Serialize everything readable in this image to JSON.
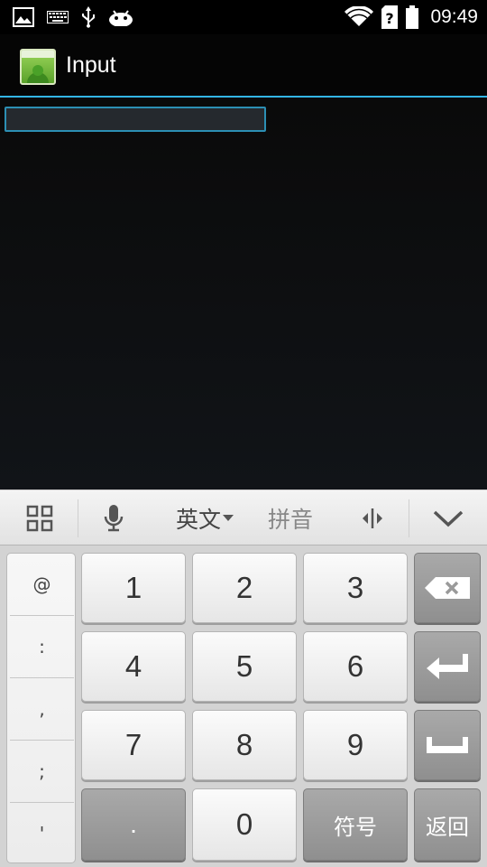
{
  "status_bar": {
    "time": "09:49",
    "left_icons": [
      "gallery-icon",
      "keyboard-icon",
      "usb-icon",
      "android-debug-icon"
    ],
    "right_icons": [
      "wifi-icon",
      "sim-unknown-icon",
      "battery-icon"
    ]
  },
  "action_bar": {
    "title": "Input",
    "accent_color": "#33b5e5"
  },
  "input": {
    "value": "",
    "placeholder": ""
  },
  "keyboard_toolbar": {
    "lang_label": "英文",
    "pinyin_label": "拼音"
  },
  "keyboard": {
    "symbols": [
      "@",
      ":",
      ",",
      ";",
      "'"
    ],
    "keys": {
      "k1": "1",
      "k2": "2",
      "k3": "3",
      "k4": "4",
      "k5": "5",
      "k6": "6",
      "k7": "7",
      "k8": "8",
      "k9": "9",
      "dot": ".",
      "k0": "0",
      "symbols_label": "符号",
      "back_label": "返回"
    }
  }
}
